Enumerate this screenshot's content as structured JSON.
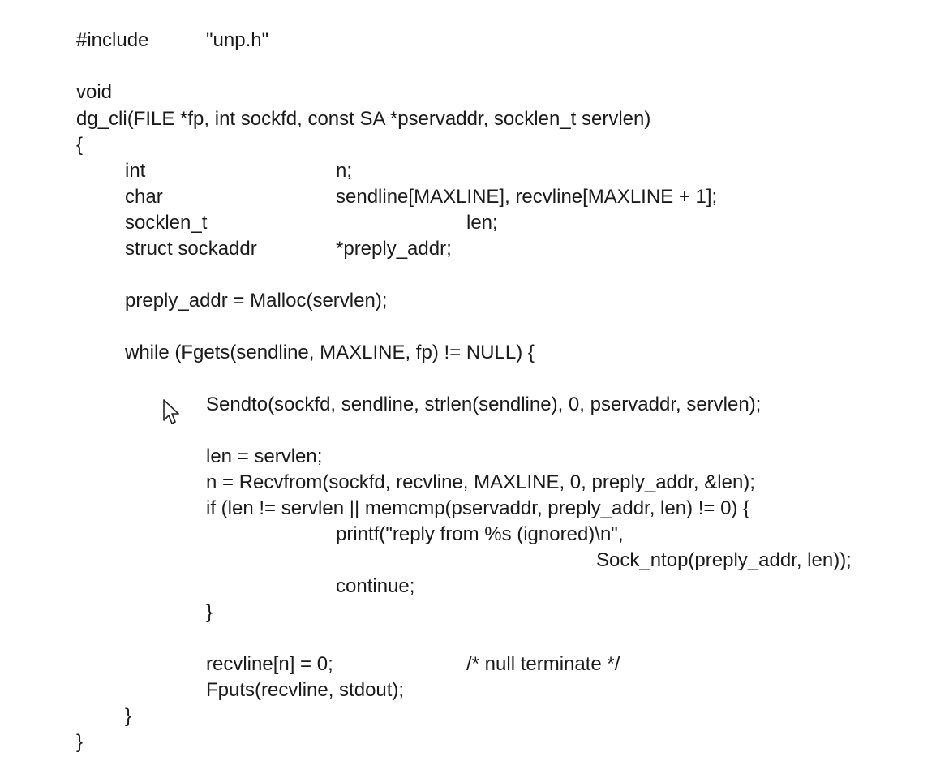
{
  "code": {
    "lines": [
      {
        "segments": [
          "#include",
          "\"unp.h\""
        ]
      },
      {
        "segments": []
      },
      {
        "segments": [
          "void"
        ]
      },
      {
        "segments": [
          "dg_cli(FILE *fp, int sockfd, const SA *pservaddr, socklen_t servlen)"
        ]
      },
      {
        "segments": [
          "{"
        ]
      },
      {
        "segments": [
          "int",
          "n;"
        ]
      },
      {
        "segments": [
          "char",
          "sendline[MAXLINE], recvline[MAXLINE + 1];"
        ]
      },
      {
        "segments": [
          "socklen_t",
          "len;"
        ]
      },
      {
        "segments": [
          "struct sockaddr",
          "*preply_addr;"
        ]
      },
      {
        "segments": []
      },
      {
        "segments": [
          "preply_addr = Malloc(servlen);"
        ]
      },
      {
        "segments": []
      },
      {
        "segments": [
          "while (Fgets(sendline, MAXLINE, fp) != NULL) {"
        ]
      },
      {
        "segments": []
      },
      {
        "segments": [
          "Sendto(sockfd, sendline, strlen(sendline), 0, pservaddr, servlen);"
        ]
      },
      {
        "segments": []
      },
      {
        "segments": [
          "len = servlen;"
        ]
      },
      {
        "segments": [
          "n = Recvfrom(sockfd, recvline, MAXLINE, 0, preply_addr, &len);"
        ]
      },
      {
        "segments": [
          "if (len != servlen || memcmp(pservaddr, preply_addr, len) != 0) {"
        ]
      },
      {
        "segments": [
          "printf(\"reply from %s (ignored)\\n\","
        ]
      },
      {
        "segments": [
          "Sock_ntop(preply_addr, len));"
        ]
      },
      {
        "segments": [
          "continue;"
        ]
      },
      {
        "segments": [
          "}"
        ]
      },
      {
        "segments": []
      },
      {
        "segments": [
          "recvline[n] = 0;",
          "/* null terminate */"
        ]
      },
      {
        "segments": [
          "Fputs(recvline, stdout);"
        ]
      },
      {
        "segments": [
          "}"
        ]
      },
      {
        "segments": [
          "}"
        ]
      }
    ]
  },
  "cursor_icon": "mouse-pointer-arrow-icon"
}
